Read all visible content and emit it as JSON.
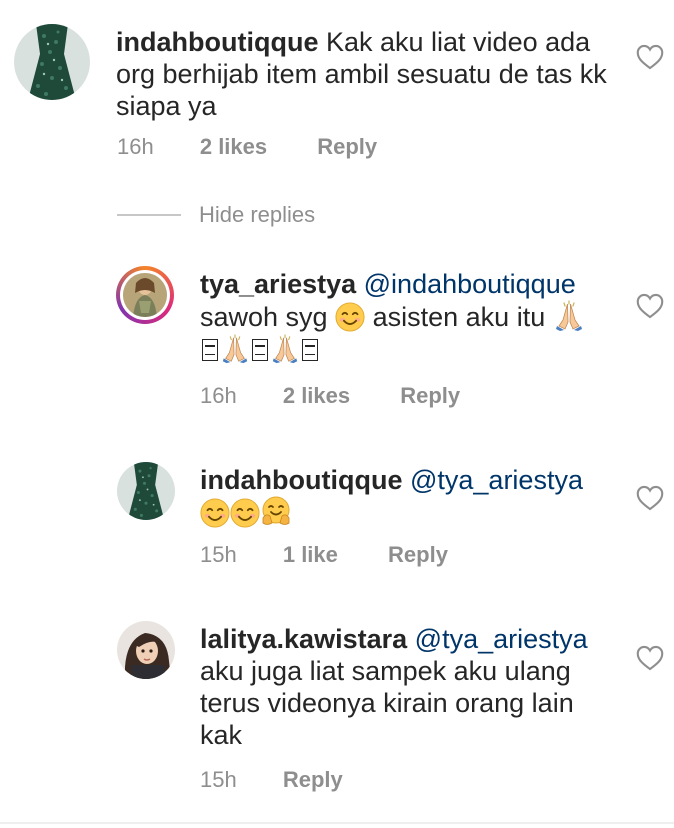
{
  "comments": [
    {
      "username": "indahboutiqque",
      "mention": "",
      "text": "Kak aku liat video ada org berhijab item ambil sesuatu de tas kk siapa ya",
      "time": "16h",
      "likes": "2 likes",
      "reply": "Reply"
    },
    {
      "username": "tya_ariestya",
      "mention": "@indahboutiqque",
      "text_a": "sawoh syg",
      "text_b": "asisten aku itu",
      "time": "16h",
      "likes": "2 likes",
      "reply": "Reply"
    },
    {
      "username": "indahboutiqque",
      "mention": "@tya_ariestya",
      "time": "15h",
      "likes": "1 like",
      "reply": "Reply"
    },
    {
      "username": "lalitya.kawistara",
      "mention": "@tya_ariestya",
      "text": "aku juga liat sampek aku ulang terus videonya kirain orang lain kak",
      "time": "15h",
      "reply": "Reply"
    }
  ],
  "hide_replies": "Hide replies",
  "icons": {
    "like": "heart-outline-icon",
    "smile": "smiling-face-emoji",
    "pray": "folded-hands-emoji",
    "hug": "hugging-face-emoji"
  },
  "colors": {
    "text": "#262626",
    "muted": "#8e8e8e",
    "mention": "#003569"
  }
}
